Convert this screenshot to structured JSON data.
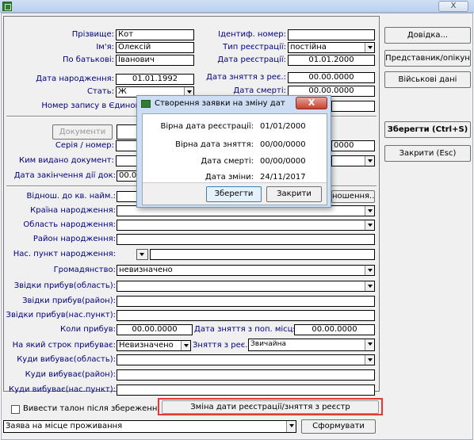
{
  "window": {
    "close_label": "X"
  },
  "person": {
    "surname_label": "Прізвище:",
    "surname": "Кот",
    "name_label": "Ім'я:",
    "name": "Олексій",
    "patronymic_label": "По батькові:",
    "patronymic": "Іванович",
    "birthdate_label": "Дата народження:",
    "birthdate": "01.01.1992",
    "sex_label": "Стать:",
    "sex": "Ж",
    "record_label": "Номер запису в Єдином"
  },
  "registration": {
    "id_label": "Ідентиф. номер:",
    "id": "",
    "type_label": "Тип реєстрації:",
    "type": "постійна",
    "reg_date_label": "Дата реєстрації:",
    "reg_date": "01.01.2000",
    "dereg_date_label": "Дата зняття з реє.:",
    "dereg_date": "00.00.0000",
    "death_date_label": "Дата смерті:",
    "death_date": "00.00.0000"
  },
  "documents": {
    "button_label": "Документи",
    "series_label": "Серія / номер:",
    "issued_by_label": "Ким видано документ:",
    "expiry_label": "Дата закінчення дії док:",
    "expiry": "00.00",
    "extra_date": "0000"
  },
  "birth": {
    "relation_label": "Віднош. до кв. найм.:",
    "relation_button": "ношення...",
    "country_label": "Країна народження:",
    "region_label": "Область народження:",
    "district_label": "Район народження:",
    "locality_label": "Нас. пункт народження:"
  },
  "citizenship": {
    "label": "Громадянство:",
    "value": "невизначено"
  },
  "arrival": {
    "region_label": "Звідки прибув(область):",
    "district_label": "Звідки прибув(район):",
    "locality_label": "Звідки прибув(нас.пункт):",
    "when_label": "Коли прибув:",
    "when": "00.00.0000",
    "prev_dereg_label": "Дата зняття з поп. місця:",
    "prev_dereg": "00.00.0000",
    "term_label": "На який строк прибуває:",
    "term": "Невизначено",
    "dereg_type_label": "Зняття з реє.:",
    "dereg_type": "Звичайна"
  },
  "departure": {
    "region_label": "Куди вибуває(область):",
    "district_label": "Куди вибуває(район):",
    "locality_label": "Куди вибуває(нас.пункт):"
  },
  "footer": {
    "print_check_label": "Вивести талон після збереження",
    "change_dates_button": "Зміна дати реєстрації/зняття з реєстр",
    "application_type": "Заява на місце проживання",
    "form_button": "Сформувати"
  },
  "side_buttons": {
    "help": "Довідка...",
    "guardian": "Представник/опікун",
    "military": "Військові дані",
    "save": "Зберегти (Ctrl+S)",
    "close": "Закрити (Esc)"
  },
  "dialog": {
    "title": "Створення заявки на зміну дат",
    "close_label": "X",
    "reg_date_label": "Вірна дата реєстрації:",
    "reg_date": "01/01/2000",
    "dereg_date_label": "Вірна дата зняття:",
    "dereg_date": "00/00/0000",
    "death_date_label": "Дата смерті:",
    "death_date": "00/00/0000",
    "change_date_label": "Дата зміни:",
    "change_date": "24/11/2017",
    "save_button": "Зберегти",
    "close_button": "Закрити"
  },
  "colors": {
    "label_blue": "#000080",
    "highlight_red": "#e53935",
    "window_bg": "#f0f0f0"
  }
}
